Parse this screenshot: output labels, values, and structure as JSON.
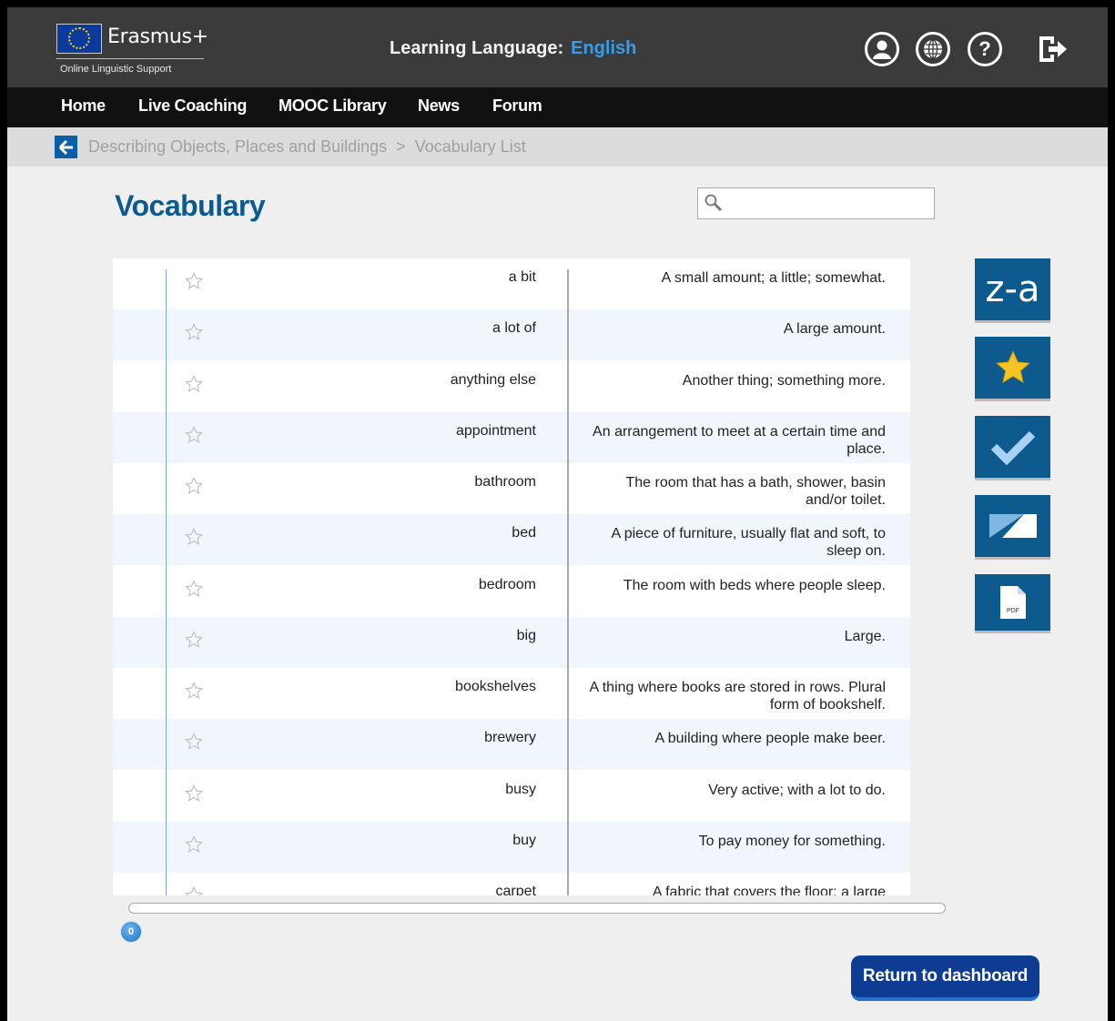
{
  "header": {
    "brand_name": "Erasmus+",
    "brand_sub": "Online Linguistic Support",
    "learning_label": "Learning Language:",
    "learning_value": "English",
    "icons": [
      "user-profile-icon",
      "globe-icon",
      "help-icon",
      "logout-icon"
    ],
    "help_glyph": "?"
  },
  "nav": {
    "items": [
      {
        "label": "Home"
      },
      {
        "label": "Live Coaching"
      },
      {
        "label": "MOOC Library"
      },
      {
        "label": "News"
      },
      {
        "label": "Forum"
      }
    ]
  },
  "breadcrumb": {
    "parent": "Describing Objects, Places and Buildings",
    "separator": ">",
    "current": "Vocabulary List"
  },
  "page": {
    "title": "Vocabulary",
    "search_placeholder": ""
  },
  "vocabulary": [
    {
      "term": "a bit",
      "definition": "A small amount; a little; somewhat."
    },
    {
      "term": "a lot of",
      "definition": "A large amount."
    },
    {
      "term": "anything else",
      "definition": "Another thing; something more."
    },
    {
      "term": "appointment",
      "definition": "An arrangement to meet at a certain time and place."
    },
    {
      "term": "bathroom",
      "definition": "The room that has a bath, shower, basin and/or toilet."
    },
    {
      "term": "bed",
      "definition": "A piece of furniture, usually flat and soft, to sleep on."
    },
    {
      "term": "bedroom",
      "definition": "The room with beds where people sleep."
    },
    {
      "term": "big",
      "definition": "Large."
    },
    {
      "term": "bookshelves",
      "definition": "A thing where books are stored in rows. Plural form of bookshelf."
    },
    {
      "term": "brewery",
      "definition": "A building where people make beer."
    },
    {
      "term": "busy",
      "definition": "Very active; with a lot to do."
    },
    {
      "term": "buy",
      "definition": "To pay money for something."
    },
    {
      "term": "carpet",
      "definition": "A fabric that covers the floor; a large"
    }
  ],
  "side_buttons": {
    "sort_label": "z-a",
    "icons": [
      "sort-za-button",
      "favorites-star-icon",
      "checkmark-icon",
      "flashcard-icon",
      "pdf-icon"
    ],
    "pdf_label": "PDF"
  },
  "progress": {
    "value": "0"
  },
  "footer": {
    "return_label": "Return to dashboard"
  },
  "colors": {
    "brand_blue": "#0d5a8e",
    "accent": "#3b9be4"
  }
}
